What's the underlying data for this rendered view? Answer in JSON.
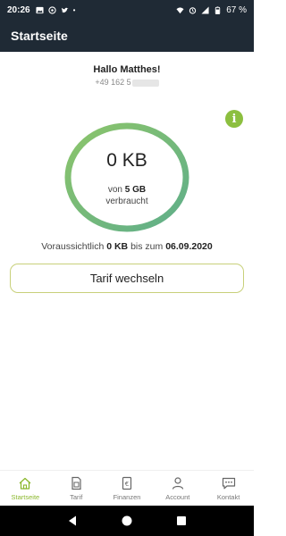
{
  "status_bar": {
    "time": "20:26",
    "battery": "67 %"
  },
  "header": {
    "title": "Startseite"
  },
  "user": {
    "greeting": "Hallo Matthes!",
    "phone": "+49 162 5"
  },
  "usage": {
    "used_value": "0 KB",
    "of_prefix": "von",
    "limit": "5 GB",
    "used_label": "verbraucht",
    "fraction_used": 0
  },
  "forecast": {
    "prefix": "Voraussichtlich",
    "amount": "0 KB",
    "middle": "bis zum",
    "date": "06.09.2020"
  },
  "actions": {
    "change_tariff": "Tarif wechseln"
  },
  "bottom_nav": [
    {
      "label": "Startseite",
      "icon": "home-icon",
      "active": true
    },
    {
      "label": "Tarif",
      "icon": "sim-card-icon",
      "active": false
    },
    {
      "label": "Finanzen",
      "icon": "euro-document-icon",
      "active": false
    },
    {
      "label": "Account",
      "icon": "person-icon",
      "active": false
    },
    {
      "label": "Kontakt",
      "icon": "chat-icon",
      "active": false
    }
  ],
  "colors": {
    "header_bg": "#1f2a35",
    "accent_green": "#8cbf3f",
    "ring_start": "#8cc56a",
    "ring_end": "#5fae8a",
    "active_nav": "#8cb82e"
  }
}
